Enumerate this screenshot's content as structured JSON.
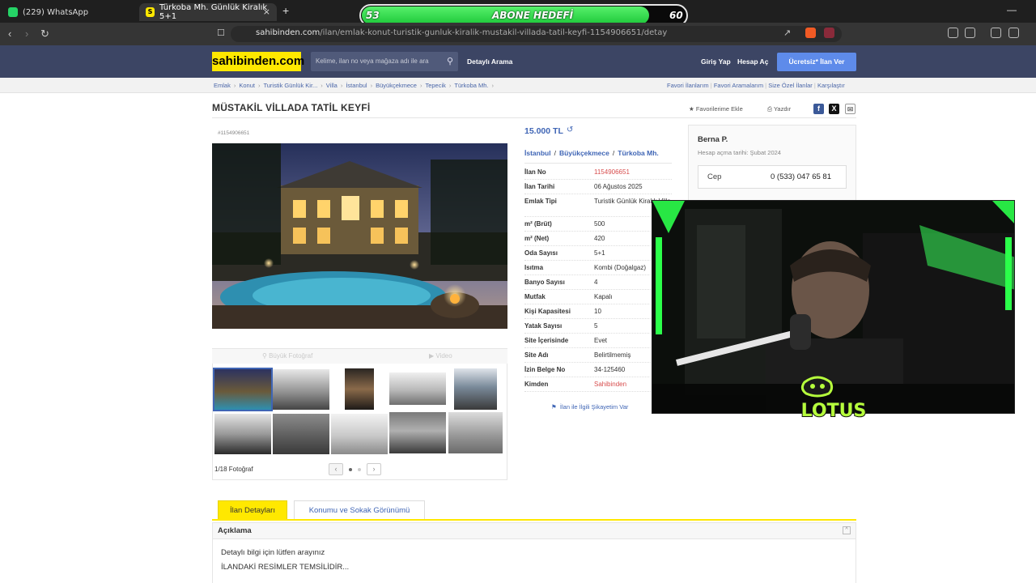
{
  "browser": {
    "tabs": [
      {
        "label": "(229) WhatsApp",
        "icon": "whatsapp-icon"
      },
      {
        "label": "Türkoba Mh. Günlük Kiralık 5+1",
        "icon": "sahibinden-icon"
      }
    ],
    "tab_close": "×",
    "new_tab": "+",
    "url_host": "sahibinden.com",
    "url_path": "/ilan/emlak-konut-turistik-gunluk-kiralik-mustakil-villada-tatil-keyfi-1154906651/detay"
  },
  "subscriber_goal": {
    "current": "53",
    "label": "ABONE HEDEFİ",
    "target": "60",
    "progress": 0.883
  },
  "site": {
    "logo": "sahibinden.com",
    "search_placeholder": "Kelime, ilan no veya mağaza adı ile ara",
    "detailed_search": "Detaylı Arama",
    "login": "Giriş Yap",
    "register": "Hesap Aç",
    "post_ad": "Ücretsiz* İlan Ver"
  },
  "breadcrumbs": [
    "Emlak",
    "Konut",
    "Turistik Günlük Kir...",
    "Villa",
    "İstanbul",
    "Büyükçekmece",
    "Tepecik",
    "Türkoba Mh."
  ],
  "breadcrumbs_right": [
    "Favori İlanlarım",
    "Favori Aramalarım",
    "Size Özel İlanlar",
    "Karşılaştır"
  ],
  "listing": {
    "title": "MÜSTAKİL VİLLADA TATİL KEYFİ",
    "add_favorite": "Favorilerime Ekle",
    "print": "Yazdır",
    "id_label": "#1154906651",
    "price": "15.000 TL",
    "location": [
      "İstanbul",
      "Büyükçekmece",
      "Türkoba Mh."
    ],
    "gallery": {
      "big_photo": "Büyük Fotoğraf",
      "video": "Video",
      "count": "1/18 Fotoğraf",
      "prev": "‹",
      "next": "›"
    },
    "details": [
      {
        "k": "İlan No",
        "v": "1154906651",
        "red": true
      },
      {
        "k": "İlan Tarihi",
        "v": "06 Ağustos 2025"
      },
      {
        "k": "Emlak Tipi",
        "v": "Turistik Günlük Kiralık Villa"
      },
      {
        "k": "m² (Brüt)",
        "v": "500"
      },
      {
        "k": "m² (Net)",
        "v": "420"
      },
      {
        "k": "Oda Sayısı",
        "v": "5+1"
      },
      {
        "k": "Isıtma",
        "v": "Kombi (Doğalgaz)"
      },
      {
        "k": "Banyo Sayısı",
        "v": "4"
      },
      {
        "k": "Mutfak",
        "v": "Kapalı"
      },
      {
        "k": "Kişi Kapasitesi",
        "v": "10"
      },
      {
        "k": "Yatak Sayısı",
        "v": "5"
      },
      {
        "k": "Site İçerisinde",
        "v": "Evet"
      },
      {
        "k": "Site Adı",
        "v": "Belirtilmemiş"
      },
      {
        "k": "İzin Belge No",
        "v": "34-125460"
      },
      {
        "k": "Kimden",
        "v": "Sahibinden",
        "red": true
      }
    ],
    "complain": "İlan ile İlgili Şikayetim Var"
  },
  "seller": {
    "name": "Berna P.",
    "since": "Hesap açma tarihi: Şubat 2024",
    "phone_label": "Cep",
    "phone": "0 (533) 047 65 81"
  },
  "detail_tabs": [
    "İlan Detayları",
    "Konumu ve Sokak Görünümü"
  ],
  "description": {
    "title": "Açıklama",
    "toggle": "^",
    "lines": [
      "Detaylı bilgi için lütfen arayınız",
      "İLANDAKİ RESİMLER TEMSİLİDİR..."
    ]
  },
  "overlay": {
    "logo_text": "LOTUS"
  },
  "colors": {
    "brand_yellow": "#ffe800",
    "header_navy": "#3c4564",
    "link_blue": "#3f65b5",
    "accent_red": "#d74d4d",
    "goal_green": "#2ed94a"
  }
}
